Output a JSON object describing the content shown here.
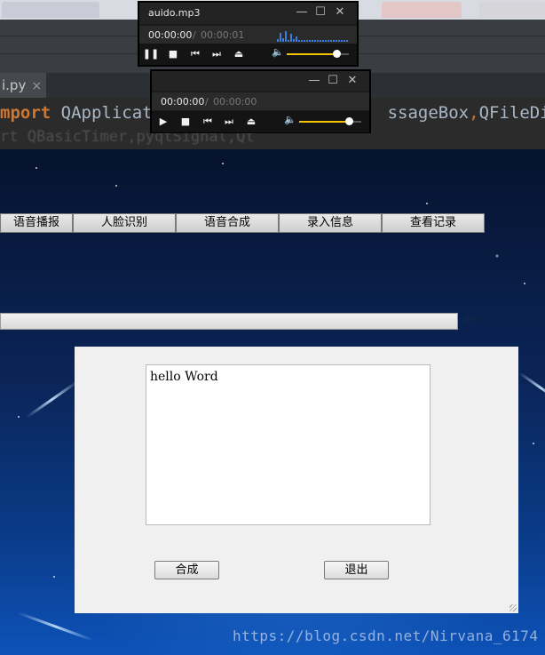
{
  "ide": {
    "file_tab_label": "i.py",
    "file_tab_close": "×",
    "code_keyword": "mport",
    "code_line1_part1": " QApplicat",
    "code_line1_part2": "ssageBox",
    "code_line1_comma": ",",
    "code_line1_part3": "QFileDia",
    "code_line2": "rt QBasicTimer,pyqtSignal,Qt"
  },
  "app": {
    "nav": [
      {
        "label": "语音播报"
      },
      {
        "label": "人脸识别"
      },
      {
        "label": "语音合成"
      },
      {
        "label": "录入信息"
      },
      {
        "label": "查看记录"
      }
    ],
    "progress": {
      "value": 0,
      "label": "0%"
    },
    "text_box": {
      "value": "hello Word"
    },
    "synth_button": "合成",
    "exit_button": "退出"
  },
  "player1": {
    "title": "auido.mp3",
    "current_time": "00:00:00",
    "separator": "/",
    "total_time": "00:00:01",
    "volume": 0.8,
    "minimize": "—",
    "maximize": "☐",
    "close": "✕"
  },
  "player2": {
    "title": "",
    "current_time": "00:00:00",
    "separator": "/",
    "total_time": "00:00:00",
    "volume": 0.8,
    "minimize": "—",
    "maximize": "☐",
    "close": "✕"
  },
  "watermark": "https://blog.csdn.net/Nirvana_6174",
  "colors": {
    "accent_volume": "#f2c400",
    "progress_fill": "#3c8d2f",
    "panel_bg": "#f0f0f0"
  }
}
